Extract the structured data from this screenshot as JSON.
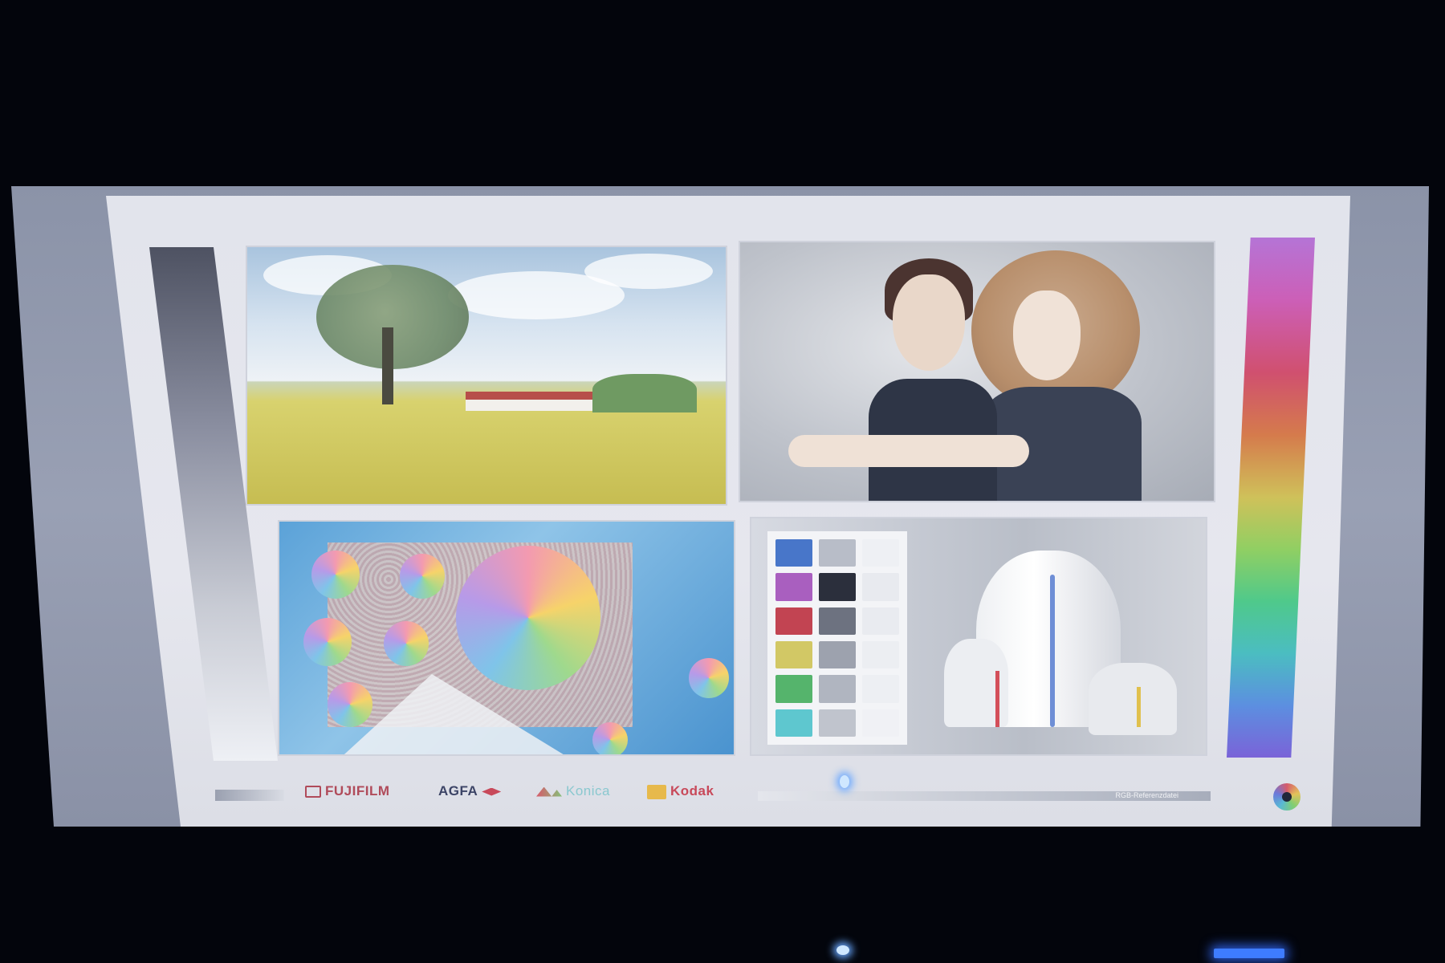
{
  "scene": {
    "subject": "projected test image on screen",
    "footer": {
      "logos": [
        {
          "name": "fujifilm",
          "label": "FUJIFILM"
        },
        {
          "name": "agfa",
          "label": "AGFA"
        },
        {
          "name": "konica",
          "label": "Konica"
        },
        {
          "name": "kodak",
          "label": "Kodak"
        }
      ],
      "bar_label": "RGB-Referenzdatei"
    },
    "colors": {
      "screen_white": "#e4e6ec",
      "background": "#03050c",
      "accent_led": "#6aa8ff"
    },
    "color_checker_patches": [
      "#4876c9",
      "#b8bdc8",
      "#eef0f4",
      "#a95fbf",
      "#2b2f3c",
      "#e8eaef",
      "#c24452",
      "#6d7280",
      "#e9ebf0",
      "#d2c865",
      "#9da2ae",
      "#eceef2",
      "#55b46c",
      "#b0b5c0",
      "#edeff3",
      "#5ec7cf",
      "#c0c4cd",
      "#f0f1f5"
    ]
  }
}
